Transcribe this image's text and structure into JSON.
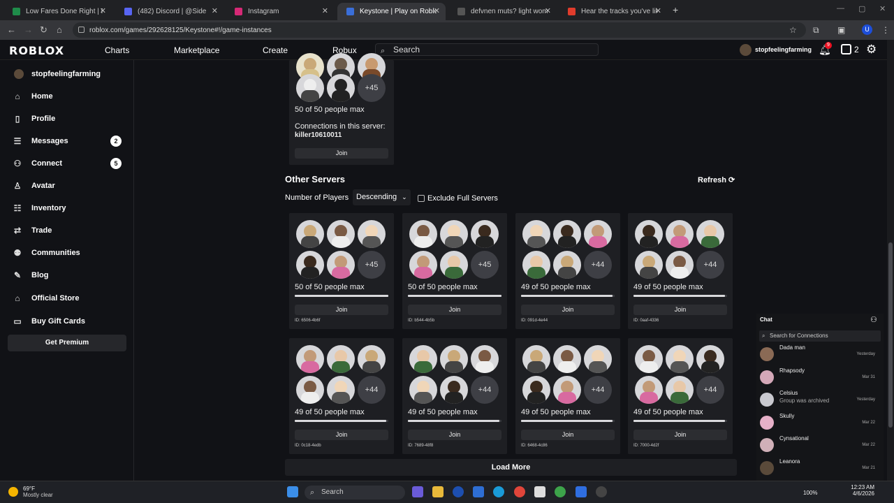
{
  "browser": {
    "tabs": [
      {
        "title": "Low Fares Done Right | Frontie",
        "favicon_color": "#1f8c4a",
        "active": false
      },
      {
        "title": "(482) Discord | @Side",
        "favicon_color": "#5865f2",
        "active": false
      },
      {
        "title": "Instagram",
        "favicon_color": "#d62976",
        "active": false
      },
      {
        "title": "Keystone | Play on Roblox",
        "favicon_color": "#3a6ed8",
        "active": true
      },
      {
        "title": "defvnen muts? light women hil",
        "favicon_color": "#555555",
        "active": false
      },
      {
        "title": "Hear the tracks you've liked: on",
        "favicon_color": "#e03c2c",
        "active": false
      }
    ],
    "url": "roblox.com/games/292628125/Keystone#!/game-instances"
  },
  "header": {
    "logo": "ROBLOX",
    "nav": [
      "Charts",
      "Marketplace",
      "Create",
      "Robux"
    ],
    "search_placeholder": "Search",
    "username": "stopfeelingfarming",
    "notif_count": "9",
    "robux": "2"
  },
  "sidebar": {
    "user": "stopfeelingfarming",
    "items": [
      {
        "label": "Home",
        "icon": "home-icon",
        "glyph": "⌂",
        "badge": ""
      },
      {
        "label": "Profile",
        "icon": "profile-icon",
        "glyph": "▯",
        "badge": ""
      },
      {
        "label": "Messages",
        "icon": "messages-icon",
        "glyph": "☰",
        "badge": "2"
      },
      {
        "label": "Connect",
        "icon": "connect-icon",
        "glyph": "⚇",
        "badge": "5"
      },
      {
        "label": "Avatar",
        "icon": "avatar-icon",
        "glyph": "♙",
        "badge": ""
      },
      {
        "label": "Inventory",
        "icon": "inventory-icon",
        "glyph": "☷",
        "badge": ""
      },
      {
        "label": "Trade",
        "icon": "trade-icon",
        "glyph": "⇄",
        "badge": ""
      },
      {
        "label": "Communities",
        "icon": "communities-icon",
        "glyph": "⚉",
        "badge": ""
      },
      {
        "label": "Blog",
        "icon": "blog-icon",
        "glyph": "✎",
        "badge": ""
      },
      {
        "label": "Official Store",
        "icon": "store-icon",
        "glyph": "⌂",
        "badge": ""
      },
      {
        "label": "Buy Gift Cards",
        "icon": "gift-card-icon",
        "glyph": "▭",
        "badge": ""
      }
    ],
    "premium": "Get Premium"
  },
  "friends_server": {
    "more": "+45",
    "capacity": "50 of 50 people max",
    "connections_label": "Connections in this server:",
    "connection_name": "killer10610011",
    "join": "Join"
  },
  "other_servers": {
    "title": "Other Servers",
    "refresh": "Refresh",
    "sort_label": "Number of Players",
    "sort_value": "Descending",
    "exclude_label": "Exclude Full Servers",
    "load_more": "Load More",
    "join": "Join",
    "servers": [
      {
        "more": "+45",
        "capacity": "50 of 50 people max",
        "id": "ID: 6506-4b6f",
        "fill": 1.0
      },
      {
        "more": "+45",
        "capacity": "50 of 50 people max",
        "id": "ID: b544-4b5b",
        "fill": 1.0
      },
      {
        "more": "+44",
        "capacity": "49 of 50 people max",
        "id": "ID: 091d-4e44",
        "fill": 0.98
      },
      {
        "more": "+44",
        "capacity": "49 of 50 people max",
        "id": "ID: 0aaf-4336",
        "fill": 0.98
      },
      {
        "more": "+44",
        "capacity": "49 of 50 people max",
        "id": "ID: 0c18-4edb",
        "fill": 0.98
      },
      {
        "more": "+44",
        "capacity": "49 of 50 people max",
        "id": "ID: 7689-48f8",
        "fill": 0.98
      },
      {
        "more": "+44",
        "capacity": "49 of 50 people max",
        "id": "ID: 6468-4c86",
        "fill": 0.98
      },
      {
        "more": "+44",
        "capacity": "49 of 50 people max",
        "id": "ID: 7000-4d2f",
        "fill": 0.98
      }
    ]
  },
  "chat": {
    "title": "Chat",
    "search_placeholder": "Search for Connections",
    "items": [
      {
        "name": "Dada man",
        "status": "",
        "date": "Yesterday"
      },
      {
        "name": "Rhapsody",
        "status": "",
        "date": "Mar 31"
      },
      {
        "name": "Celsius",
        "status": "Group was archived",
        "date": "Yesterday"
      },
      {
        "name": "Skully",
        "status": "",
        "date": "Mar 22"
      },
      {
        "name": "Cynsational",
        "status": "",
        "date": "Mar 22"
      },
      {
        "name": "Leanora",
        "status": "",
        "date": "Mar 21"
      }
    ]
  },
  "taskbar": {
    "temp": "69°F",
    "weather": "Mostly clear",
    "search": "Search",
    "battery": "100%",
    "time": "12:23 AM",
    "date": "4/6/2026"
  }
}
